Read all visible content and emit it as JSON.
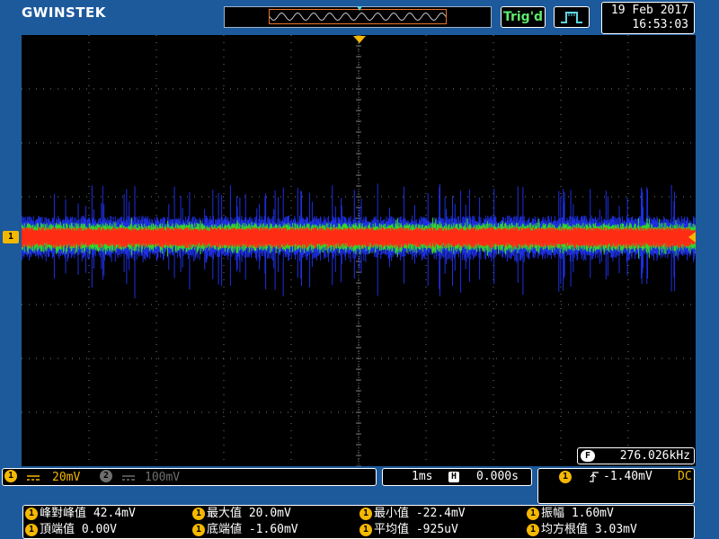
{
  "brand": "GWINSTEK",
  "trigger": {
    "status": "Trig'd",
    "mode_icon": "pulse-trigger-icon",
    "slope_icon": "rising-edge-icon",
    "level": "-1.40mV",
    "coupling": "DC"
  },
  "datetime": {
    "date": "19 Feb 2017",
    "time": "16:53:03"
  },
  "channel1": {
    "badge": "1",
    "coupling_icon": "dc-coupling-icon",
    "scale": "20mV",
    "color": "#f5b800"
  },
  "channel2": {
    "badge": "2",
    "coupling_icon": "dc-coupling-icon",
    "scale": "100mV"
  },
  "timebase": {
    "scale": "1ms",
    "position": "0.000s"
  },
  "frequency": {
    "icon": "F",
    "value": "276.026kHz"
  },
  "measurements": [
    {
      "badge": "1",
      "label": "峰對峰值",
      "value": "42.4mV"
    },
    {
      "badge": "1",
      "label": "最大值",
      "value": "20.0mV"
    },
    {
      "badge": "1",
      "label": "最小值",
      "value": "-22.4mV"
    },
    {
      "badge": "1",
      "label": "振幅",
      "value": "1.60mV"
    },
    {
      "badge": "1",
      "label": "頂端值",
      "value": "0.00V"
    },
    {
      "badge": "1",
      "label": "底端値",
      "value": "-1.60mV"
    },
    {
      "badge": "1",
      "label": "平均值",
      "value": "-925uV"
    },
    {
      "badge": "1",
      "label": "均方根值",
      "value": "3.03mV"
    }
  ],
  "colors": {
    "background": "#1d5a9c",
    "screen": "#000000",
    "grid": "#7a7a7a",
    "trace_outer": "#1d2fe0",
    "trace_mid": "#34d42b",
    "trace_core": "#ff2d14",
    "accent": "#f5b800"
  }
}
